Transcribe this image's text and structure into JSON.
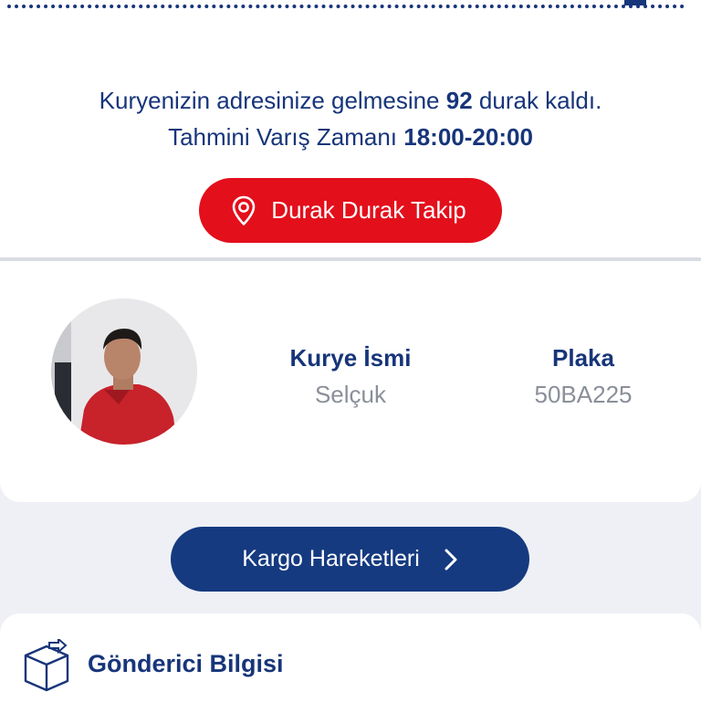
{
  "delivery_info": {
    "line1_prefix": "Kuryenizin adresinize gelmesine",
    "stops_remaining": "92",
    "line1_suffix": "durak kaldı.",
    "eta_label": "Tahmini Varış Zamanı",
    "eta_value": "18:00-20:00"
  },
  "track_button": {
    "label": "Durak Durak Takip",
    "icon": "location-pin-icon",
    "color": "#e30f1b"
  },
  "courier": {
    "name_label": "Kurye İsmi",
    "name_value": "Selçuk",
    "plate_label": "Plaka",
    "plate_value": "50BA225"
  },
  "movements_button": {
    "label": "Kargo Hareketleri",
    "icon": "chevron-right-icon",
    "color": "#153a80"
  },
  "sender_section": {
    "title": "Gönderici Bilgisi",
    "icon": "box-icon"
  }
}
